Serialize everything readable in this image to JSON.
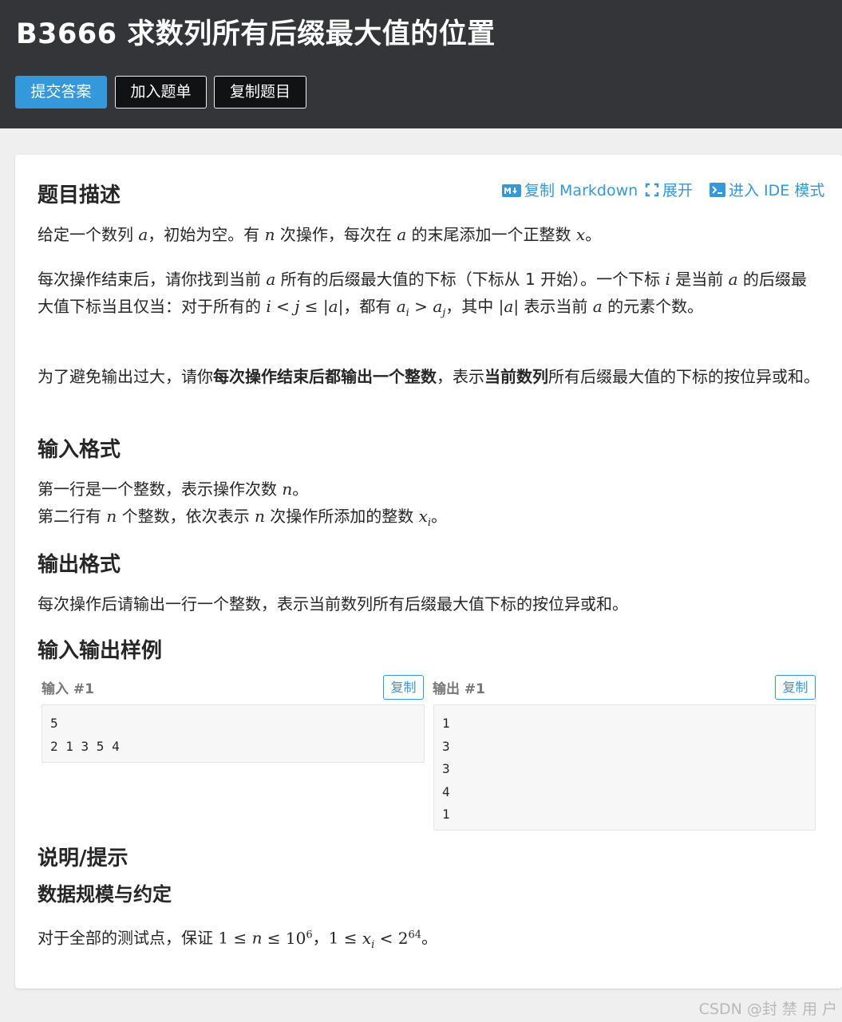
{
  "header": {
    "title": "B3666 求数列所有后缀最大值的位置",
    "buttons": {
      "submit": "提交答案",
      "add_to_list": "加入题单",
      "copy_problem": "复制题目"
    }
  },
  "toolbar": {
    "copy_markdown": "复制 Markdown",
    "expand": "展开",
    "ide_mode": "进入 IDE 模式"
  },
  "sections": {
    "description_title": "题目描述",
    "input_format_title": "输入格式",
    "output_format_title": "输出格式",
    "samples_title": "输入输出样例",
    "hint_title": "说明/提示",
    "constraints_title": "数据规模与约定"
  },
  "text": {
    "d1_a": "给定一个数列 ",
    "d1_b": "，初始为空。有 ",
    "d1_c": " 次操作，每次在 ",
    "d1_d": " 的末尾添加一个正整数 ",
    "d1_e": "。",
    "d2_a": "每次操作结束后，请你找到当前 ",
    "d2_b": " 所有的后缀最大值的下标（下标从 1 开始）。一个下标 ",
    "d2_c": " 是当前 ",
    "d2_d": " 的后缀最大值下标当且仅当：对于所有的 ",
    "d2_e": "，都有 ",
    "d2_f": "，其中 ",
    "d2_g": " 表示当前 ",
    "d2_h": " 的元素个数。",
    "d3_a": "为了避免输出过大，请你",
    "d3_bold1": "每次操作结束后都输出一个整数",
    "d3_b": "，表示",
    "d3_bold2": "当前数列",
    "d3_c": "所有后缀最大值的下标的按位异或和。",
    "in1_a": "第一行是一个整数，表示操作次数 ",
    "in1_b": "。",
    "in2_a": "第二行有 ",
    "in2_b": " 个整数，依次表示 ",
    "in2_c": " 次操作所添加的整数 ",
    "in2_d": "。",
    "out1": "每次操作后请输出一行一个整数，表示当前数列所有后缀最大值下标的按位异或和。",
    "c1_a": "对于全部的测试点，保证 ",
    "c1_b": "，",
    "c1_c": "。"
  },
  "samples": {
    "input_label": "输入 #1",
    "output_label": "输出 #1",
    "copy_label": "复制",
    "input": "5\n2 1 3 5 4",
    "output": "1\n3\n3\n4\n1"
  },
  "watermark": "CSDN @封 禁 用 户"
}
